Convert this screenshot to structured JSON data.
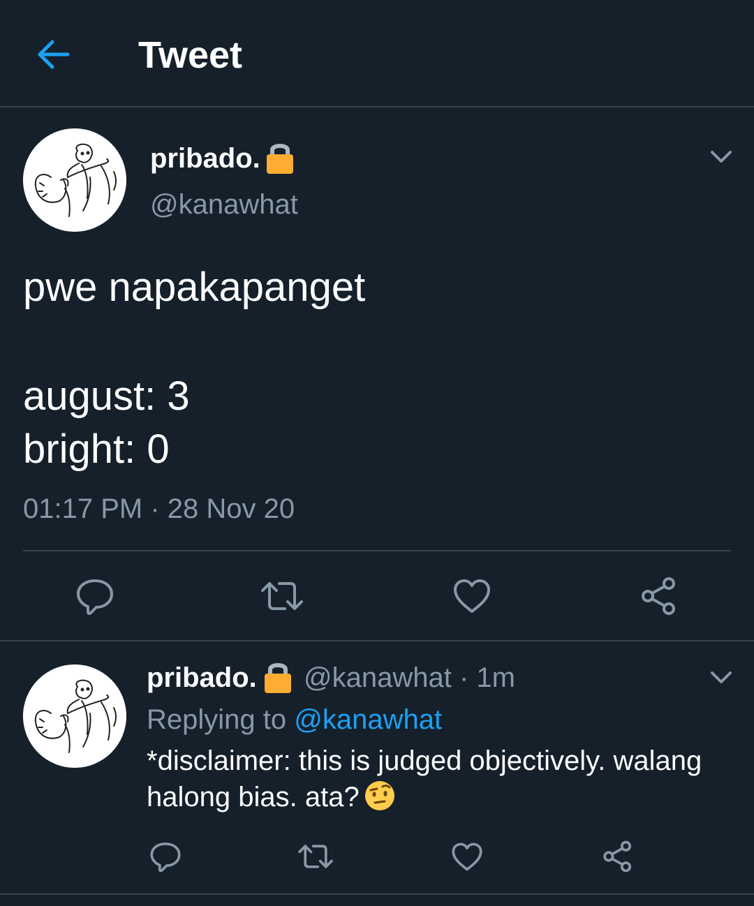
{
  "header": {
    "back_icon": "arrow-left-icon",
    "title": "Tweet"
  },
  "colors": {
    "background": "#15202b",
    "accent": "#1da1f2",
    "secondary_text": "#8899a6",
    "divider": "#38444d",
    "lock": "#ffac33"
  },
  "main_tweet": {
    "display_name": "pribado.",
    "protected_icon": "lock-icon",
    "handle": "@kanawhat",
    "menu_icon": "chevron-down-icon",
    "text_lines": [
      "pwe napakapanget",
      "",
      "august: 3",
      "bright: 0"
    ],
    "timestamp": "01:17 PM · 28 Nov 20",
    "actions": [
      "reply-icon",
      "retweet-icon",
      "like-icon",
      "share-icon"
    ]
  },
  "reply_tweet": {
    "display_name": "pribado.",
    "protected_icon": "lock-icon",
    "handle_time": "@kanawhat · 1m",
    "replying_prefix": "Replying to",
    "replying_mention": "@kanawhat",
    "text_lines": [
      "*disclaimer: this is judged objectively. walang",
      "halong bias. ata?"
    ],
    "emoji": "face-with-raised-eyebrow-emoji",
    "menu_icon": "chevron-down-icon",
    "actions": [
      "reply-icon",
      "retweet-icon",
      "like-icon",
      "share-icon"
    ]
  }
}
